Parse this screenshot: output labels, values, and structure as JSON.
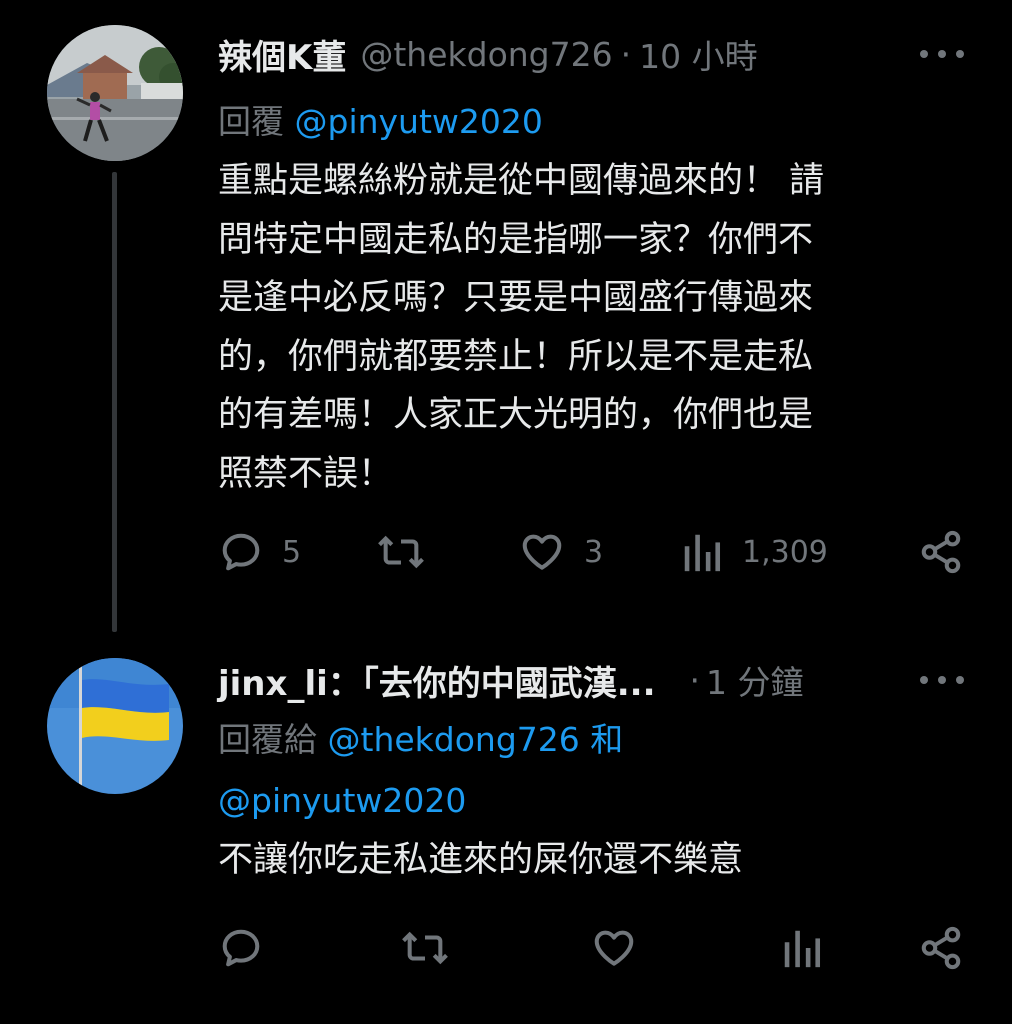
{
  "tweets": [
    {
      "display_name": "辣個K董",
      "handle": "@thekdong726",
      "separator": "·",
      "time": "10 小時",
      "reply_prefix": "回覆",
      "reply_mention": "@pinyutw2020",
      "text_lines": [
        "重點是螺絲粉就是從中國傳過來的！ 請",
        "問特定中國走私的是指哪一家？你們不",
        "是逢中必反嗎？只要是中國盛行傳過來",
        "的，你們就都要禁止！所以是不是走私",
        "的有差嗎！人家正大光明的，你們也是",
        "照禁不誤！"
      ],
      "replies": "5",
      "retweets": "",
      "likes": "3",
      "views": "1,309"
    },
    {
      "display_name": "jinx_li：「去你的中國武漢...",
      "separator": "·",
      "time": "1 分鐘",
      "reply_prefix": "回覆給",
      "reply_mention_1": "@thekdong726",
      "reply_join": "和",
      "reply_mention_2": "@pinyutw2020",
      "text": "不讓你吃走私進來的屎你還不樂意",
      "replies": "",
      "retweets": "",
      "likes": "",
      "views": ""
    }
  ],
  "icons": {
    "more": "more-horizontal-icon",
    "reply": "reply-icon",
    "retweet": "retweet-icon",
    "like": "heart-icon",
    "views": "views-chart-icon",
    "share": "share-icon"
  },
  "colors": {
    "background": "#000000",
    "text_primary": "#e7e9ea",
    "text_secondary": "#71767b",
    "link": "#1d9bf0",
    "thread_line": "#333639"
  }
}
